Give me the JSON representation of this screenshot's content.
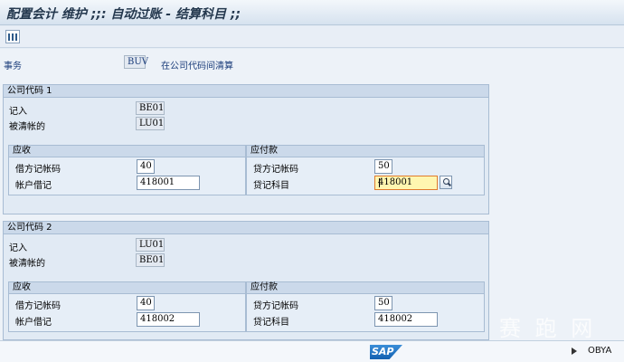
{
  "title": "配置会计 维护 ;;: 自动过账 - 结算科目 ;;",
  "toolbar": {
    "icon": "column-layout-icon"
  },
  "transaction": {
    "label": "事务",
    "code": "BUV",
    "description": "在公司代码间清算"
  },
  "company1": {
    "header": "公司代码 1",
    "post_label": "记入",
    "post_value": "BE01",
    "cleared_label": "被清帐的",
    "cleared_value": "LU01",
    "receivable": {
      "header": "应收",
      "key_label": "借方记帐码",
      "key_value": "40",
      "account_label": "帐户借记",
      "account_value": "418001"
    },
    "payable": {
      "header": "应付款",
      "key_label": "贷方记帐码",
      "key_value": "50",
      "account_label": "贷记科目",
      "account_value": "418001"
    }
  },
  "company2": {
    "header": "公司代码 2",
    "post_label": "记入",
    "post_value": "LU01",
    "cleared_label": "被清帐的",
    "cleared_value": "BE01",
    "receivable": {
      "header": "应收",
      "key_label": "借方记帐码",
      "key_value": "40",
      "account_label": "帐户借记",
      "account_value": "418002"
    },
    "payable": {
      "header": "应付款",
      "key_label": "贷方记帐码",
      "key_value": "50",
      "account_label": "贷记科目",
      "account_value": "418002"
    }
  },
  "status": {
    "logo": "SAP",
    "system": "OBYA"
  },
  "watermark": "赛 跑 网"
}
